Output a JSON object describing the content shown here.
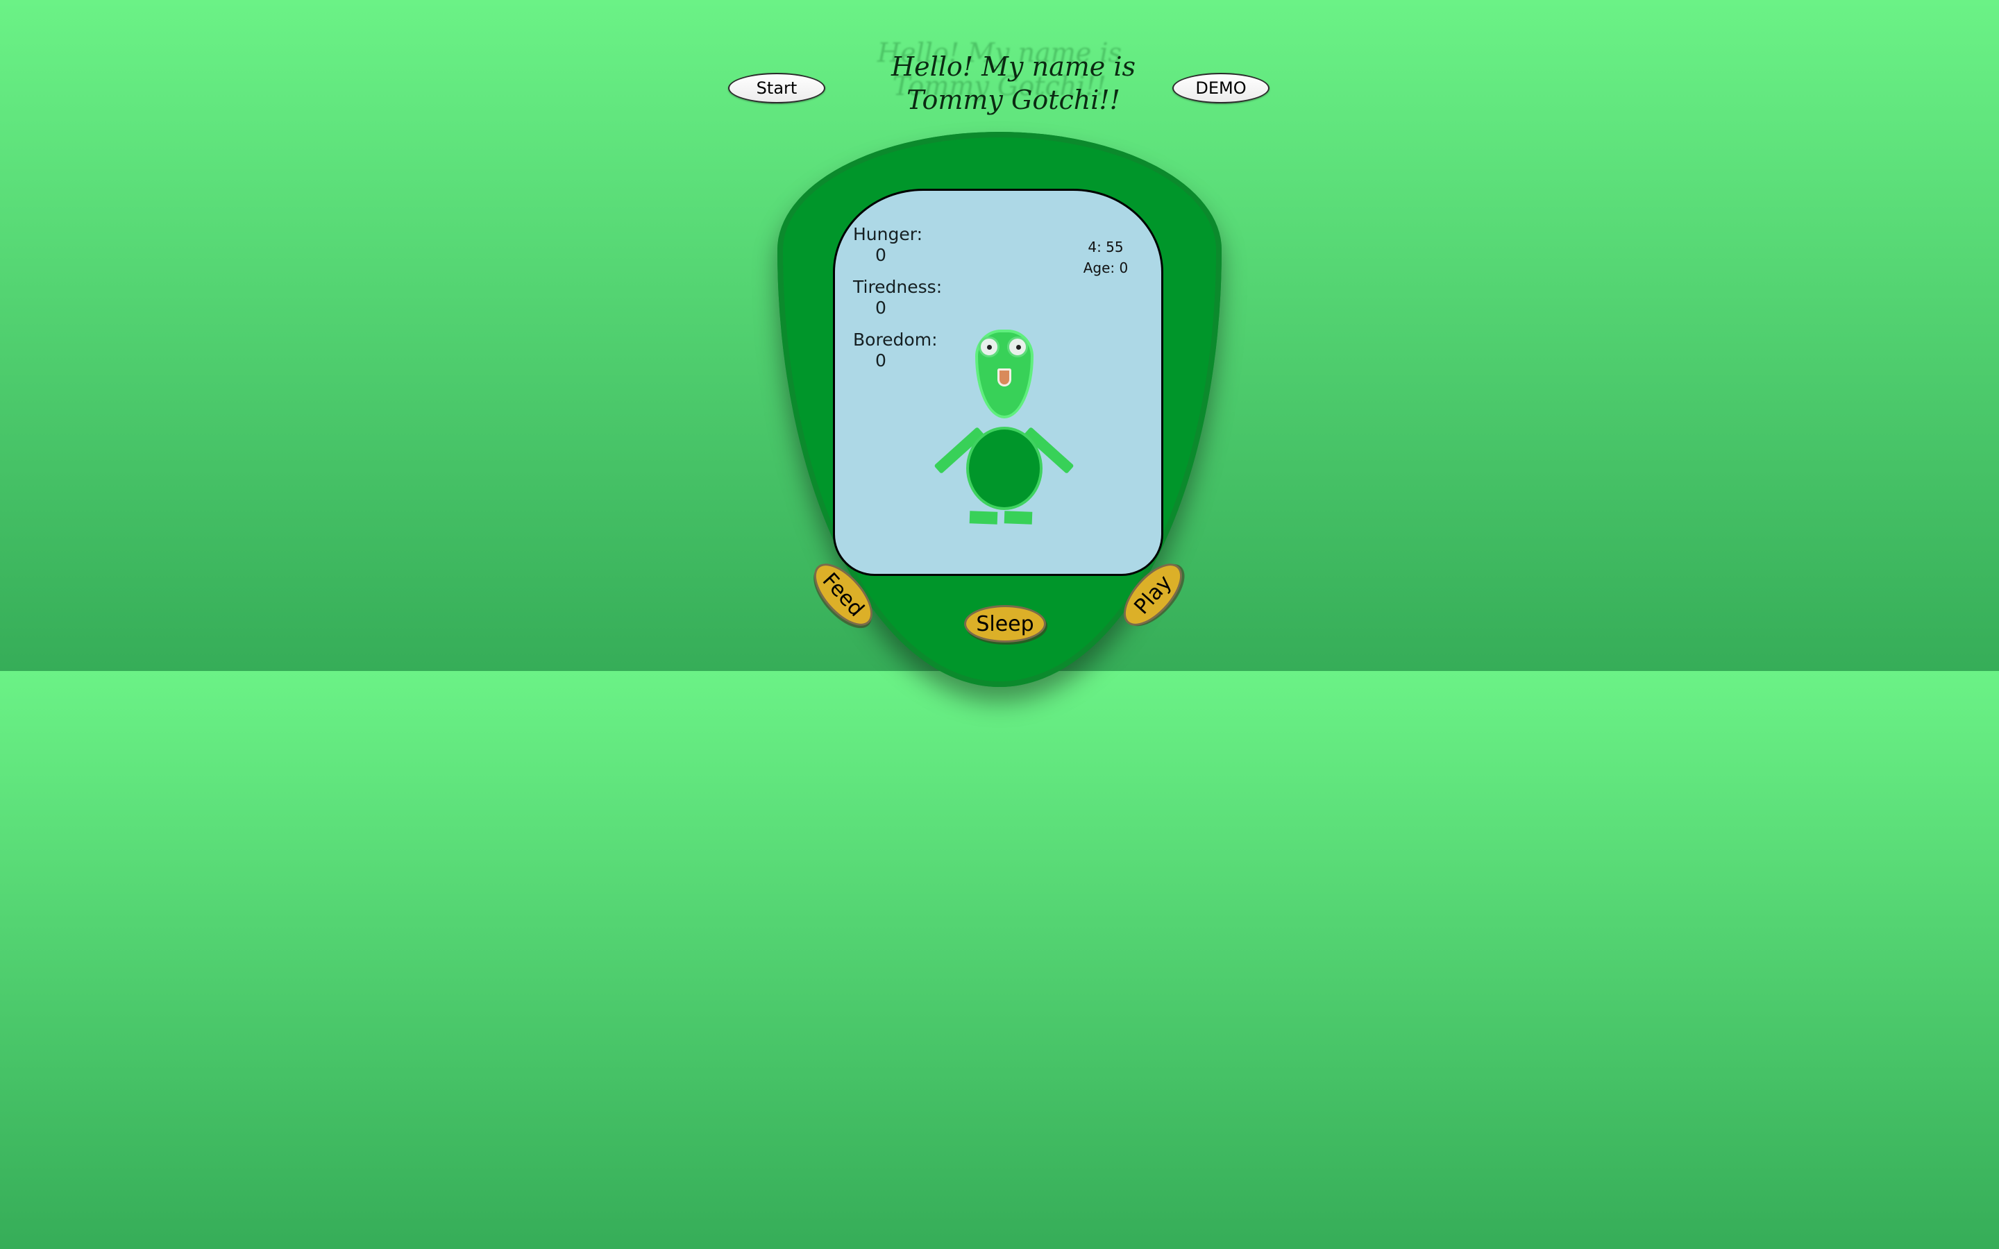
{
  "header": {
    "start_label": "Start",
    "demo_label": "DEMO",
    "title_line1": "Hello! My name is",
    "title_line2": "Tommy Gotchi!!"
  },
  "stats": {
    "hunger_label": "Hunger:",
    "hunger_value": "0",
    "tiredness_label": "Tiredness:",
    "tiredness_value": "0",
    "boredom_label": "Boredom:",
    "boredom_value": "0"
  },
  "clock": {
    "time": "4: 55",
    "age": "Age: 0"
  },
  "actions": {
    "feed_label": "Feed",
    "sleep_label": "Sleep",
    "play_label": "Play"
  },
  "colors": {
    "background_top": "#6bf286",
    "background_bottom": "#36ad58",
    "device": "#00962a",
    "screen": "#add8e6",
    "button": "#dcb028",
    "pet_green": "#38d158"
  }
}
